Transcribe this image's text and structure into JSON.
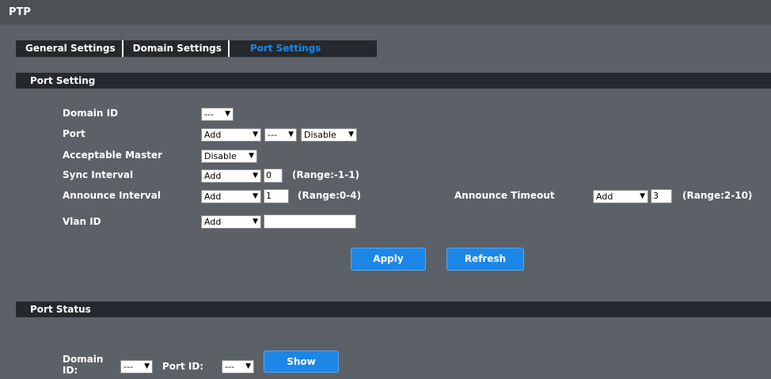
{
  "page": {
    "title": "PTP"
  },
  "tabs": [
    {
      "label": "General Settings",
      "active": false
    },
    {
      "label": "Domain Settings",
      "active": false
    },
    {
      "label": "Port Settings",
      "active": true
    }
  ],
  "port_setting": {
    "header": "Port Setting",
    "domain_id": {
      "label": "Domain ID",
      "value": "---"
    },
    "port": {
      "label": "Port",
      "mode": "Add",
      "port": "---",
      "state": "Disable"
    },
    "acceptable_master": {
      "label": "Acceptable Master",
      "value": "Disable"
    },
    "sync_interval": {
      "label": "Sync Interval",
      "mode": "Add",
      "value": "0",
      "range": "(Range:-1-1)"
    },
    "announce_interval": {
      "label": "Announce Interval",
      "mode": "Add",
      "value": "1",
      "range": "(Range:0-4)"
    },
    "announce_timeout": {
      "label": "Announce Timeout",
      "mode": "Add",
      "value": "3",
      "range": "(Range:2-10)"
    },
    "vlan_id": {
      "label": "Vlan ID",
      "mode": "Add",
      "value": ""
    },
    "apply_label": "Apply",
    "refresh_label": "Refresh"
  },
  "port_status": {
    "header": "Port Status",
    "domain_id_label_1": "Domain",
    "domain_id_label_2": "ID:",
    "domain_id_value": "---",
    "port_id_label": "Port ID:",
    "port_id_value": "---",
    "show_label": "Show"
  },
  "colors": {
    "background": "#5c6167",
    "header_bar": "#25282c",
    "accent_blue": "#1c87e7",
    "active_tab_text": "#1d86e8"
  },
  "icons": {
    "dropdown": "caret-down-icon"
  }
}
